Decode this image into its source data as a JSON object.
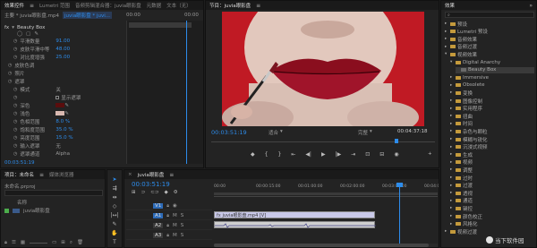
{
  "effect_controls": {
    "tabs": [
      "效果控件",
      "Lumetri 范围",
      "音频剪辑混合器：juvia眼影盘",
      "元数据",
      "文本（无）"
    ],
    "source_label": "主要 * juvia眼影盘.mp4",
    "clip_label": "juvia眼影盘 * juvi...",
    "timecode_start": "00:00",
    "timecode_end": "00:00",
    "effect_name": "Beauty Box",
    "params": [
      {
        "label": "平滑数量",
        "value": "91.00"
      },
      {
        "label": "皮肤平滑中等",
        "value": "48.00"
      },
      {
        "label": "对比度增强",
        "value": "25.00"
      },
      {
        "label": "皮肤色调",
        "value": ""
      },
      {
        "label": "照片",
        "value": ""
      },
      {
        "label": "遮罩",
        "value": ""
      },
      {
        "label": "模式",
        "value": "关"
      },
      {
        "label": "",
        "value": "显示遮罩"
      },
      {
        "label": "深色",
        "value": ""
      },
      {
        "label": "浅色",
        "value": ""
      },
      {
        "label": "色相范围",
        "value": "8.0 %"
      },
      {
        "label": "饱和度范围",
        "value": "35.0 %"
      },
      {
        "label": "亮度范围",
        "value": "15.0 %"
      },
      {
        "label": "输入遮罩",
        "value": "无"
      },
      {
        "label": "遮罩通道",
        "value": "Alpha"
      }
    ],
    "bottom_timecode": "00:03:51:19",
    "colors": {
      "dark_swatch": "#5a0d0d",
      "light_swatch": "#d8b8b0"
    }
  },
  "program_monitor": {
    "title": "节目：juvia眼影盘",
    "timecode": "00:03:51:19",
    "fit": "适合",
    "quality": "完整",
    "duration": "00:04:37:18"
  },
  "effects_panel": {
    "title": "效果",
    "items": [
      {
        "label": "预设",
        "indent": 0
      },
      {
        "label": "Lumetri 预设",
        "indent": 0
      },
      {
        "label": "音频效果",
        "indent": 0
      },
      {
        "label": "音频过渡",
        "indent": 0
      },
      {
        "label": "视频效果",
        "indent": 0
      },
      {
        "label": "Digital Anarchy",
        "indent": 1
      },
      {
        "label": "Beauty Box",
        "indent": 2,
        "selected": true
      },
      {
        "label": "Immersive",
        "indent": 1
      },
      {
        "label": "Obsolete",
        "indent": 1
      },
      {
        "label": "变换",
        "indent": 1
      },
      {
        "label": "图像控制",
        "indent": 1
      },
      {
        "label": "实用程序",
        "indent": 1
      },
      {
        "label": "扭曲",
        "indent": 1
      },
      {
        "label": "时间",
        "indent": 1
      },
      {
        "label": "杂色与颗粒",
        "indent": 1
      },
      {
        "label": "模糊与锐化",
        "indent": 1
      },
      {
        "label": "沉浸式视频",
        "indent": 1
      },
      {
        "label": "生成",
        "indent": 1
      },
      {
        "label": "视频",
        "indent": 1
      },
      {
        "label": "调整",
        "indent": 1
      },
      {
        "label": "过时",
        "indent": 1
      },
      {
        "label": "过渡",
        "indent": 1
      },
      {
        "label": "透视",
        "indent": 1
      },
      {
        "label": "通道",
        "indent": 1
      },
      {
        "label": "键控",
        "indent": 1
      },
      {
        "label": "颜色校正",
        "indent": 1
      },
      {
        "label": "风格化",
        "indent": 1
      },
      {
        "label": "视频过渡",
        "indent": 0
      }
    ]
  },
  "project_panel": {
    "tabs": [
      "项目：未命名",
      "媒体浏览器"
    ],
    "project_file": "未命名.prproj",
    "column_name": "名称",
    "item_name": "juvia眼影盘"
  },
  "timeline": {
    "tab": "juvia眼影盘",
    "timecode": "00:03:51:19",
    "ruler": [
      "00:00",
      "00:00:15:00",
      "00:01:00:00",
      "00:02:00:00",
      "00:03:00:00",
      "00:04:00:00"
    ],
    "tracks": [
      {
        "name": "V1",
        "type": "video"
      },
      {
        "name": "A1",
        "type": "audio"
      },
      {
        "name": "A2",
        "type": "audio"
      },
      {
        "name": "A3",
        "type": "audio"
      }
    ],
    "clip_label": "juvia眼影盘.mp4 [V]",
    "playhead_fraction": 0.83
  },
  "watermark": "当下软件园"
}
